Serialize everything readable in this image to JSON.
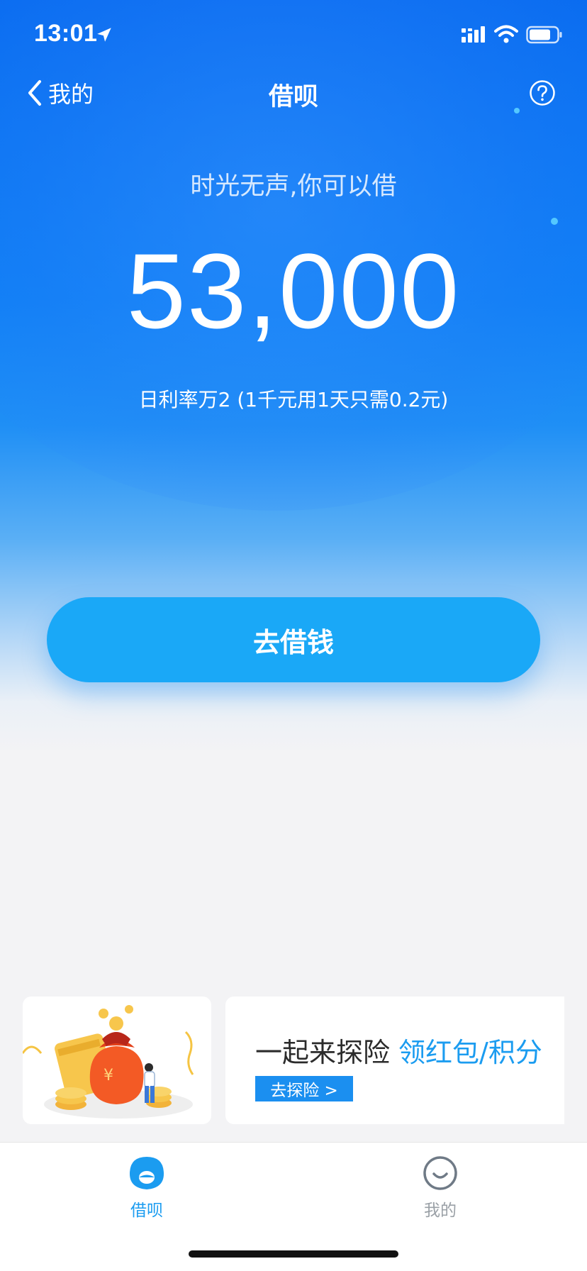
{
  "status_bar": {
    "time": "13:01"
  },
  "nav": {
    "back_label": "我的",
    "title": "借呗"
  },
  "hero": {
    "slogan": "时光无声,你可以借",
    "amount": "53,000",
    "rate_text": "日利率万2 (1千元用1天只需0.2元)"
  },
  "action": {
    "borrow_label": "去借钱"
  },
  "banner": {
    "headline_dark": "一起来探险",
    "headline_blue": "领红包/积分",
    "cta_label": "去探险 >"
  },
  "tabbar": {
    "items": [
      {
        "label": "借呗",
        "icon": "jiebei-tab-icon",
        "active": true
      },
      {
        "label": "我的",
        "icon": "smile-face-icon",
        "active": false
      }
    ]
  },
  "colors": {
    "primary_blue": "#0f7ff5",
    "button_blue": "#1aa8f7",
    "accent_blue": "#1b9cf0",
    "inactive_gray": "#9aa0a6",
    "background": "#f3f3f5"
  }
}
